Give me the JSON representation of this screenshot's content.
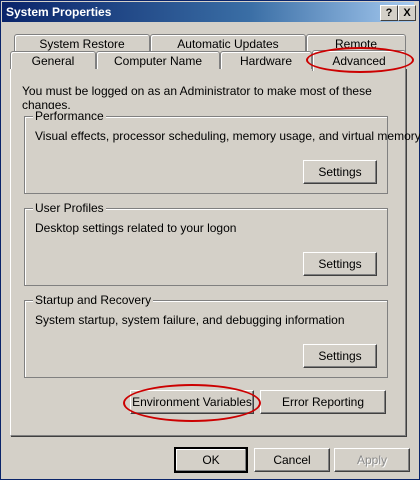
{
  "window": {
    "title": "System Properties",
    "help_glyph": "?",
    "close_glyph": "X"
  },
  "tabs": {
    "system_restore": "System Restore",
    "automatic_updates": "Automatic Updates",
    "remote": "Remote",
    "general": "General",
    "computer_name": "Computer Name",
    "hardware": "Hardware",
    "advanced": "Advanced"
  },
  "panel": {
    "admin_note": "You must be logged on as an Administrator to make most of these changes.",
    "performance": {
      "title": "Performance",
      "description": "Visual effects, processor scheduling, memory usage, and virtual memory",
      "settings_label": "Settings"
    },
    "user_profiles": {
      "title": "User Profiles",
      "description": "Desktop settings related to your logon",
      "settings_label": "Settings"
    },
    "startup_recovery": {
      "title": "Startup and Recovery",
      "description": "System startup, system failure, and debugging information",
      "settings_label": "Settings"
    },
    "environment_variables_label": "Environment Variables",
    "error_reporting_label": "Error Reporting"
  },
  "footer": {
    "ok_label": "OK",
    "cancel_label": "Cancel",
    "apply_label": "Apply"
  },
  "annotation_color": "#cc0000"
}
